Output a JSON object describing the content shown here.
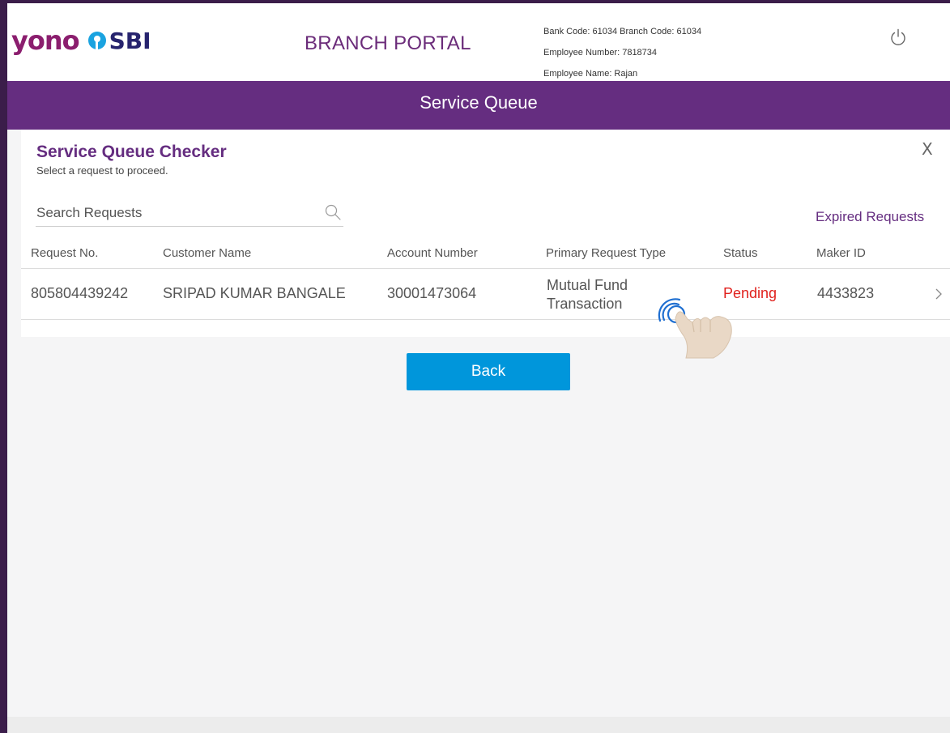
{
  "header": {
    "logo_yono": "yono",
    "logo_sbi": "SBI",
    "portal_title": "BRANCH PORTAL",
    "bank_code_line": "Bank Code: 61034 Branch Code: 61034",
    "employee_number_line": "Employee Number: 7818734",
    "employee_name_line": "Employee Name: Rajan",
    "power_icon": "power-icon"
  },
  "title_bar": {
    "title": "Service Queue"
  },
  "panel": {
    "title": "Service Queue Checker",
    "subtitle": "Select a request to proceed.",
    "close_label": "X",
    "search_placeholder": "Search Requests",
    "search_icon": "search-icon",
    "expired_link": "Expired Requests",
    "columns": [
      "Request No.",
      "Customer Name",
      "Account Number",
      "Primary Request Type",
      "Status",
      "Maker ID"
    ],
    "rows": [
      {
        "request_no": "805804439242",
        "customer_name": "SRIPAD KUMAR BANGALE",
        "account_number": "30001473064",
        "type_line1": "Mutual Fund",
        "type_line2": "Transaction",
        "status": "Pending",
        "maker_id": "4433823"
      }
    ]
  },
  "back_label": "Back",
  "colors": {
    "brand_purple": "#652d80",
    "logo_magenta": "#8b1e6e",
    "button_blue": "#0096db",
    "status_pending": "#e0211d"
  }
}
